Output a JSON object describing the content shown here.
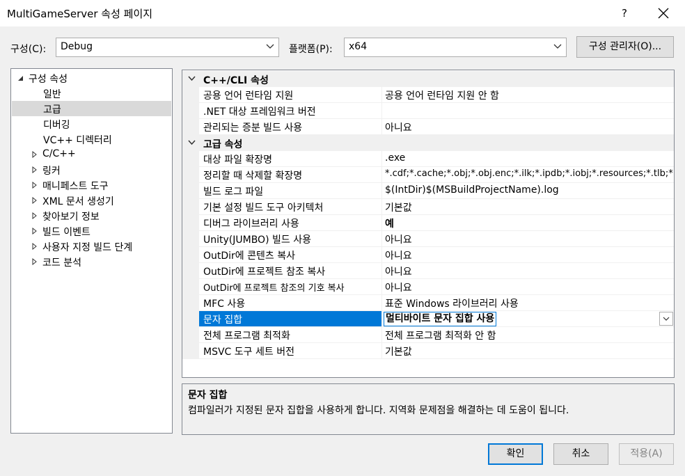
{
  "window": {
    "title": "MultiGameServer 속성 페이지",
    "help_label": "?"
  },
  "config": {
    "label": "구성(C):",
    "value": "Debug"
  },
  "platform": {
    "label": "플랫폼(P):",
    "value": "x64"
  },
  "config_manager_label": "구성 관리자(O)...",
  "tree": {
    "items": [
      {
        "label": "구성 속성",
        "toggle": "expanded"
      },
      {
        "label": "일반"
      },
      {
        "label": "고급",
        "selected": true
      },
      {
        "label": "디버깅"
      },
      {
        "label": "VC++ 디렉터리"
      },
      {
        "label": "C/C++",
        "toggle": "collapsed"
      },
      {
        "label": "링커",
        "toggle": "collapsed"
      },
      {
        "label": "매니페스트 도구",
        "toggle": "collapsed"
      },
      {
        "label": "XML 문서 생성기",
        "toggle": "collapsed"
      },
      {
        "label": "찾아보기 정보",
        "toggle": "collapsed"
      },
      {
        "label": "빌드 이벤트",
        "toggle": "collapsed"
      },
      {
        "label": "사용자 지정 빌드 단계",
        "toggle": "collapsed"
      },
      {
        "label": "코드 분석",
        "toggle": "collapsed"
      }
    ]
  },
  "grid": {
    "categories": [
      {
        "label": "C++/CLI 속성",
        "rows": [
          {
            "name": "공용 언어 런타임 지원",
            "value": "공용 언어 런타임 지원 안 함"
          },
          {
            "name": ".NET 대상 프레임워크 버전",
            "value": ""
          },
          {
            "name": "관리되는 증분 빌드 사용",
            "value": "아니요"
          }
        ]
      },
      {
        "label": "고급 속성",
        "rows": [
          {
            "name": "대상 파일 확장명",
            "value": ".exe"
          },
          {
            "name": "정리할 때 삭제할 확장명",
            "value": "*.cdf;*.cache;*.obj;*.obj.enc;*.ilk;*.ipdb;*.iobj;*.resources;*.tlb;*.tli;"
          },
          {
            "name": "빌드 로그 파일",
            "value": "$(IntDir)$(MSBuildProjectName).log"
          },
          {
            "name": "기본 설정 빌드 도구 아키텍처",
            "value": "기본값"
          },
          {
            "name": "디버그 라이브러리 사용",
            "value": "예",
            "bold": true
          },
          {
            "name": "Unity(JUMBO) 빌드 사용",
            "value": "아니요"
          },
          {
            "name": "OutDir에 콘텐츠 복사",
            "value": "아니요"
          },
          {
            "name": "OutDir에 프로젝트 참조 복사",
            "value": "아니요"
          },
          {
            "name": "OutDir에 프로젝트 참조의 기호 복사",
            "value": "아니요"
          },
          {
            "name": "MFC 사용",
            "value": "표준 Windows 라이브러리 사용"
          },
          {
            "name": "문자 집합",
            "value": "멀티바이트 문자 집합 사용",
            "bold": true,
            "selected": true
          },
          {
            "name": "전체 프로그램 최적화",
            "value": "전체 프로그램 최적화 안 함"
          },
          {
            "name": "MSVC 도구 세트 버전",
            "value": "기본값"
          }
        ]
      }
    ]
  },
  "description": {
    "title": "문자 집합",
    "text": "컴파일러가 지정된 문자 집합을 사용하게 합니다. 지역화 문제점을 해결하는 데 도움이 됩니다."
  },
  "buttons": {
    "ok": "확인",
    "cancel": "취소",
    "apply": "적용(A)"
  },
  "colors": {
    "accent": "#0078d7",
    "selection_tree": "#d9d9d9",
    "gutter": "#f0f0f0"
  }
}
